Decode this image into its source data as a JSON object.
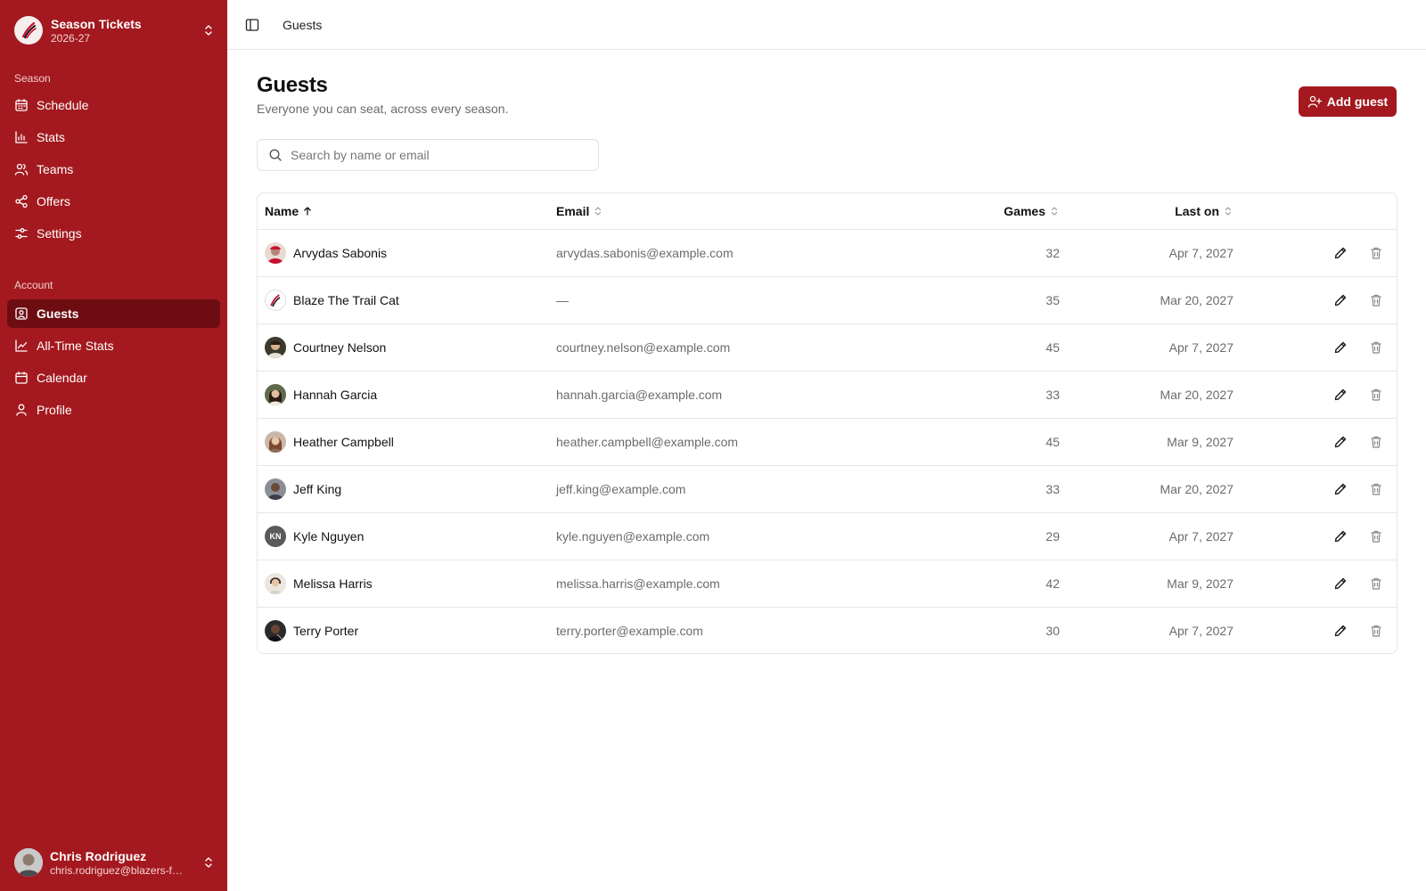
{
  "sidebar": {
    "brand": {
      "title": "Season Tickets",
      "subtitle": "2026-27"
    },
    "groups": [
      {
        "label": "Season",
        "items": [
          {
            "label": "Schedule",
            "icon": "calendar-grid-icon"
          },
          {
            "label": "Stats",
            "icon": "bar-chart-icon"
          },
          {
            "label": "Teams",
            "icon": "users-icon"
          },
          {
            "label": "Offers",
            "icon": "share-icon"
          },
          {
            "label": "Settings",
            "icon": "sliders-icon"
          }
        ]
      },
      {
        "label": "Account",
        "items": [
          {
            "label": "Guests",
            "icon": "contact-icon",
            "active": true
          },
          {
            "label": "All-Time Stats",
            "icon": "line-chart-icon"
          },
          {
            "label": "Calendar",
            "icon": "calendar-icon"
          },
          {
            "label": "Profile",
            "icon": "user-icon"
          }
        ]
      }
    ],
    "user": {
      "name": "Chris Rodriguez",
      "email": "chris.rodriguez@blazers-fan.example.com"
    }
  },
  "topbar": {
    "breadcrumb": "Guests"
  },
  "main": {
    "title": "Guests",
    "subtitle": "Everyone you can seat, across every season.",
    "add_button": "Add guest",
    "search_placeholder": "Search by name or email",
    "columns": {
      "name": "Name",
      "email": "Email",
      "games": "Games",
      "last_on": "Last on"
    },
    "sort": {
      "column": "name",
      "direction": "asc"
    },
    "rows": [
      {
        "name": "Arvydas Sabonis",
        "email": "arvydas.sabonis@example.com",
        "games": "32",
        "last_on": "Apr 7, 2027",
        "avatar": "photo"
      },
      {
        "name": "Blaze The Trail Cat",
        "email": "—",
        "games": "35",
        "last_on": "Mar 20, 2027",
        "avatar": "logo"
      },
      {
        "name": "Courtney Nelson",
        "email": "courtney.nelson@example.com",
        "games": "45",
        "last_on": "Apr 7, 2027",
        "avatar": "photo"
      },
      {
        "name": "Hannah Garcia",
        "email": "hannah.garcia@example.com",
        "games": "33",
        "last_on": "Mar 20, 2027",
        "avatar": "photo"
      },
      {
        "name": "Heather Campbell",
        "email": "heather.campbell@example.com",
        "games": "45",
        "last_on": "Mar 9, 2027",
        "avatar": "photo"
      },
      {
        "name": "Jeff King",
        "email": "jeff.king@example.com",
        "games": "33",
        "last_on": "Mar 20, 2027",
        "avatar": "photo"
      },
      {
        "name": "Kyle Nguyen",
        "email": "kyle.nguyen@example.com",
        "games": "29",
        "last_on": "Apr 7, 2027",
        "avatar": "initials",
        "initials": "KN"
      },
      {
        "name": "Melissa Harris",
        "email": "melissa.harris@example.com",
        "games": "42",
        "last_on": "Mar 9, 2027",
        "avatar": "photo"
      },
      {
        "name": "Terry Porter",
        "email": "terry.porter@example.com",
        "games": "30",
        "last_on": "Apr 7, 2027",
        "avatar": "photo"
      }
    ]
  },
  "colors": {
    "sidebar_bg": "#a3191f",
    "active_item": "#6d0d12",
    "accent": "#a3191f"
  }
}
